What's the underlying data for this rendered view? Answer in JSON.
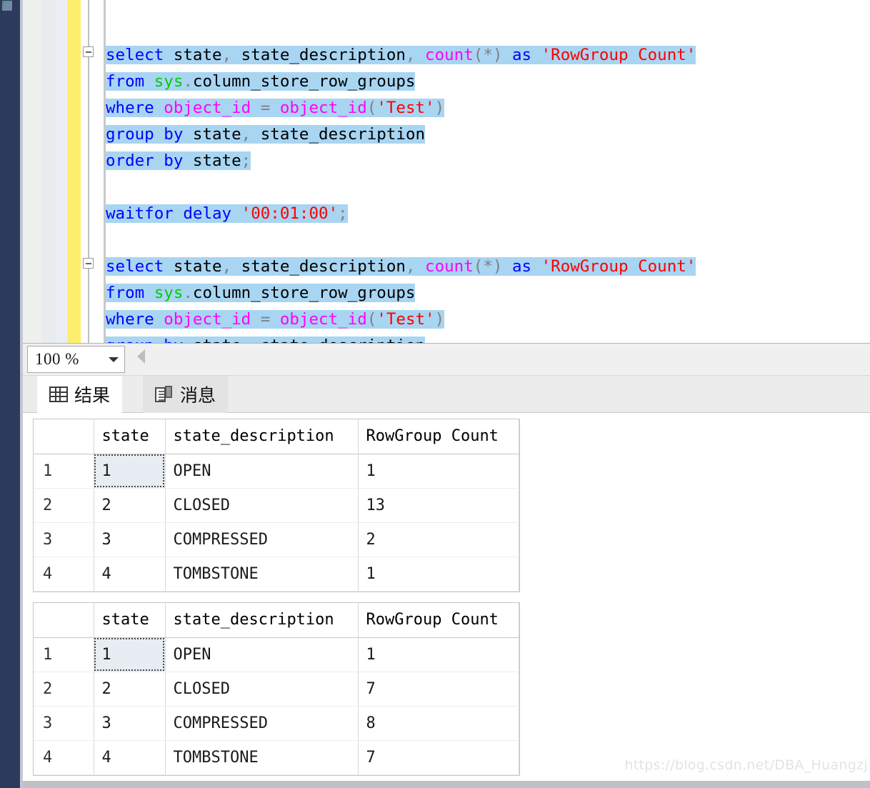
{
  "editor": {
    "language": "sql",
    "zoom_level": "100 %",
    "collapse_glyph": "minus",
    "lines": [
      {
        "indent": 0,
        "collapse": false,
        "tokens": []
      },
      {
        "indent": 0,
        "collapse": true,
        "tokens": [
          {
            "t": "select",
            "c": "kw",
            "sel": true
          },
          {
            "t": " ",
            "c": "plain",
            "sel": true
          },
          {
            "t": "state",
            "c": "plain",
            "sel": true
          },
          {
            "t": ",",
            "c": "gray",
            "sel": true
          },
          {
            "t": " state_description",
            "c": "plain",
            "sel": true
          },
          {
            "t": ",",
            "c": "gray",
            "sel": true
          },
          {
            "t": " ",
            "c": "plain",
            "sel": true
          },
          {
            "t": "count",
            "c": "fn",
            "sel": true
          },
          {
            "t": "(*)",
            "c": "gray",
            "sel": true
          },
          {
            "t": " ",
            "c": "plain",
            "sel": true
          },
          {
            "t": "as",
            "c": "kw",
            "sel": true
          },
          {
            "t": " ",
            "c": "plain",
            "sel": true
          },
          {
            "t": "'RowGroup Count'",
            "c": "str",
            "sel": true
          }
        ]
      },
      {
        "indent": 0,
        "collapse": false,
        "tokens": [
          {
            "t": "from",
            "c": "kw",
            "sel": true
          },
          {
            "t": " ",
            "c": "plain",
            "sel": true
          },
          {
            "t": "sys",
            "c": "sys",
            "sel": true
          },
          {
            "t": ".",
            "c": "gray",
            "sel": true
          },
          {
            "t": "column_store_row_groups",
            "c": "plain",
            "sel": true
          }
        ]
      },
      {
        "indent": 0,
        "collapse": false,
        "tokens": [
          {
            "t": "where",
            "c": "kw",
            "sel": true
          },
          {
            "t": " ",
            "c": "plain",
            "sel": true
          },
          {
            "t": "object_id",
            "c": "fn",
            "sel": true
          },
          {
            "t": " ",
            "c": "plain",
            "sel": true
          },
          {
            "t": "=",
            "c": "gray",
            "sel": true
          },
          {
            "t": " ",
            "c": "plain",
            "sel": true
          },
          {
            "t": "object_id",
            "c": "fn",
            "sel": true
          },
          {
            "t": "(",
            "c": "gray",
            "sel": true
          },
          {
            "t": "'Test'",
            "c": "str",
            "sel": true
          },
          {
            "t": ")",
            "c": "gray",
            "sel": true
          }
        ]
      },
      {
        "indent": 0,
        "collapse": false,
        "tokens": [
          {
            "t": "group",
            "c": "kw",
            "sel": true
          },
          {
            "t": " ",
            "c": "plain",
            "sel": true
          },
          {
            "t": "by",
            "c": "kw",
            "sel": true
          },
          {
            "t": " ",
            "c": "plain",
            "sel": true
          },
          {
            "t": "state",
            "c": "plain",
            "sel": true
          },
          {
            "t": ",",
            "c": "gray",
            "sel": true
          },
          {
            "t": " state_description",
            "c": "plain",
            "sel": true
          }
        ]
      },
      {
        "indent": 0,
        "collapse": false,
        "tokens": [
          {
            "t": "order",
            "c": "kw",
            "sel": true
          },
          {
            "t": " ",
            "c": "plain",
            "sel": true
          },
          {
            "t": "by",
            "c": "kw",
            "sel": true
          },
          {
            "t": " ",
            "c": "plain",
            "sel": true
          },
          {
            "t": "state",
            "c": "plain",
            "sel": true
          },
          {
            "t": ";",
            "c": "gray",
            "sel": true
          }
        ]
      },
      {
        "indent": 0,
        "collapse": false,
        "tokens": []
      },
      {
        "indent": 0,
        "collapse": false,
        "tokens": [
          {
            "t": "waitfor",
            "c": "kw",
            "sel": true
          },
          {
            "t": " ",
            "c": "plain",
            "sel": true
          },
          {
            "t": "delay",
            "c": "kw",
            "sel": true
          },
          {
            "t": " ",
            "c": "plain",
            "sel": true
          },
          {
            "t": "'00:01:00'",
            "c": "str",
            "sel": true
          },
          {
            "t": ";",
            "c": "gray",
            "sel": true
          }
        ]
      },
      {
        "indent": 0,
        "collapse": false,
        "tokens": []
      },
      {
        "indent": 0,
        "collapse": true,
        "tokens": [
          {
            "t": "select",
            "c": "kw",
            "sel": true
          },
          {
            "t": " ",
            "c": "plain",
            "sel": true
          },
          {
            "t": "state",
            "c": "plain",
            "sel": true
          },
          {
            "t": ",",
            "c": "gray",
            "sel": true
          },
          {
            "t": " state_description",
            "c": "plain",
            "sel": true
          },
          {
            "t": ",",
            "c": "gray",
            "sel": true
          },
          {
            "t": " ",
            "c": "plain",
            "sel": true
          },
          {
            "t": "count",
            "c": "fn",
            "sel": true
          },
          {
            "t": "(*)",
            "c": "gray",
            "sel": true
          },
          {
            "t": " ",
            "c": "plain",
            "sel": true
          },
          {
            "t": "as",
            "c": "kw",
            "sel": true
          },
          {
            "t": " ",
            "c": "plain",
            "sel": true
          },
          {
            "t": "'RowGroup Count'",
            "c": "str",
            "sel": true
          }
        ]
      },
      {
        "indent": 0,
        "collapse": false,
        "tokens": [
          {
            "t": "from",
            "c": "kw",
            "sel": true
          },
          {
            "t": " ",
            "c": "plain",
            "sel": true
          },
          {
            "t": "sys",
            "c": "sys",
            "sel": true
          },
          {
            "t": ".",
            "c": "gray",
            "sel": true
          },
          {
            "t": "column_store_row_groups",
            "c": "plain",
            "sel": true
          }
        ]
      },
      {
        "indent": 0,
        "collapse": false,
        "tokens": [
          {
            "t": "where",
            "c": "kw",
            "sel": true
          },
          {
            "t": " ",
            "c": "plain",
            "sel": true
          },
          {
            "t": "object_id",
            "c": "fn",
            "sel": true
          },
          {
            "t": " ",
            "c": "plain",
            "sel": true
          },
          {
            "t": "=",
            "c": "gray",
            "sel": true
          },
          {
            "t": " ",
            "c": "plain",
            "sel": true
          },
          {
            "t": "object_id",
            "c": "fn",
            "sel": true
          },
          {
            "t": "(",
            "c": "gray",
            "sel": true
          },
          {
            "t": "'Test'",
            "c": "str",
            "sel": true
          },
          {
            "t": ")",
            "c": "gray",
            "sel": true
          }
        ]
      },
      {
        "indent": 0,
        "collapse": false,
        "tokens": [
          {
            "t": "group",
            "c": "kw",
            "sel": true
          },
          {
            "t": " ",
            "c": "plain",
            "sel": true
          },
          {
            "t": "by",
            "c": "kw",
            "sel": true
          },
          {
            "t": " ",
            "c": "plain",
            "sel": true
          },
          {
            "t": "state",
            "c": "plain",
            "sel": true
          },
          {
            "t": ",",
            "c": "gray",
            "sel": true
          },
          {
            "t": " state_description",
            "c": "plain",
            "sel": true
          }
        ]
      }
    ]
  },
  "toolbar": {
    "zoom_value": "100 %",
    "zoom_dropdown_icon": "chevron-down-icon",
    "scroll_left_icon": "triangle-left-icon"
  },
  "tabs": [
    {
      "id": "results",
      "label": "结果",
      "icon": "grid-icon",
      "active": true
    },
    {
      "id": "messages",
      "label": "消息",
      "icon": "message-icon",
      "active": false
    }
  ],
  "grids": [
    {
      "id": "result-grid-1",
      "columns": [
        "",
        "state",
        "state_description",
        "RowGroup Count"
      ],
      "rows": [
        {
          "num": "1",
          "state": "1",
          "state_description": "OPEN",
          "count": "1",
          "focused": true
        },
        {
          "num": "2",
          "state": "2",
          "state_description": "CLOSED",
          "count": "13",
          "focused": false
        },
        {
          "num": "3",
          "state": "3",
          "state_description": "COMPRESSED",
          "count": "2",
          "focused": false
        },
        {
          "num": "4",
          "state": "4",
          "state_description": "TOMBSTONE",
          "count": "1",
          "focused": false
        }
      ]
    },
    {
      "id": "result-grid-2",
      "columns": [
        "",
        "state",
        "state_description",
        "RowGroup Count"
      ],
      "rows": [
        {
          "num": "1",
          "state": "1",
          "state_description": "OPEN",
          "count": "1",
          "focused": true
        },
        {
          "num": "2",
          "state": "2",
          "state_description": "CLOSED",
          "count": "7",
          "focused": false
        },
        {
          "num": "3",
          "state": "3",
          "state_description": "COMPRESSED",
          "count": "8",
          "focused": false
        },
        {
          "num": "4",
          "state": "4",
          "state_description": "TOMBSTONE",
          "count": "7",
          "focused": false
        }
      ]
    }
  ],
  "watermark": "https://blog.csdn.net/DBA_Huangzj",
  "colors": {
    "keyword": "#0000ff",
    "function": "#ff00ff",
    "string": "#ff0000",
    "schema": "#00cc00",
    "punctuation": "#808080",
    "selection": "#a8d5f2",
    "change_bar": "#fdef6b",
    "rail": "#2c3a5c"
  }
}
